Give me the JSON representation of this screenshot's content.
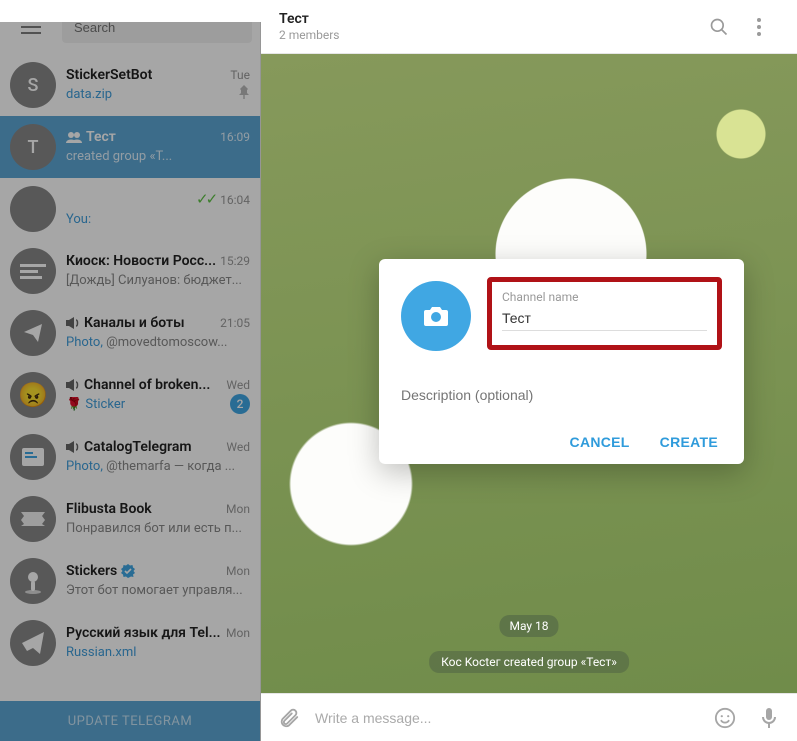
{
  "sidebar": {
    "search_placeholder": "Search",
    "update_label": "UPDATE TELEGRAM",
    "items": [
      {
        "title": "StickerSetBot",
        "time": "Tue",
        "preview_html": "<span class='link-text'>data.zip</span>",
        "pin": true
      },
      {
        "title": "Тест",
        "time": "16:09",
        "preview_html": "created group «Т...",
        "group": true,
        "selected": true
      },
      {
        "title": "",
        "time": "16:04",
        "preview_html": "<span class='link-text'>You:</span>",
        "checks": true
      },
      {
        "title": "Киоск: Новости Росс...",
        "time": "15:29",
        "preview_html": "[Дождь]  Силуанов: бюджет..."
      },
      {
        "title": "Каналы и боты",
        "time": "21:05",
        "preview_html": "<span class='link-text'>Photo,</span> @movedtomoscow...",
        "mega": true
      },
      {
        "title": "Channel of broken...",
        "time": "Wed",
        "preview_html": "🌹 <span class='link-text'>Sticker</span>",
        "mega": true,
        "badge": "2"
      },
      {
        "title": "CatalogTelegram",
        "time": "Wed",
        "preview_html": "<span class='link-text'>Photo,</span> @themarfa — когда ...",
        "mega": true
      },
      {
        "title": "Flibusta Book",
        "time": "Mon",
        "preview_html": "Понравился бот или есть п..."
      },
      {
        "title": "Stickers",
        "time": "Mon",
        "preview_html": "Этот бот помогает управля...",
        "verified": true
      },
      {
        "title": "Русский язык для Tel...",
        "time": "Mon",
        "preview_html": "<span class='link-text'>Russian.xml</span>"
      }
    ]
  },
  "header": {
    "title": "Тест",
    "subtitle": "2 members"
  },
  "chat": {
    "date_badge": "May 18",
    "service_msg": "Кос Koctег created group «Тест»",
    "composer_placeholder": "Write a message..."
  },
  "dialog": {
    "field_label": "Channel name",
    "name_value": "Тест",
    "description_placeholder": "Description (optional)",
    "cancel_label": "CANCEL",
    "create_label": "CREATE"
  }
}
